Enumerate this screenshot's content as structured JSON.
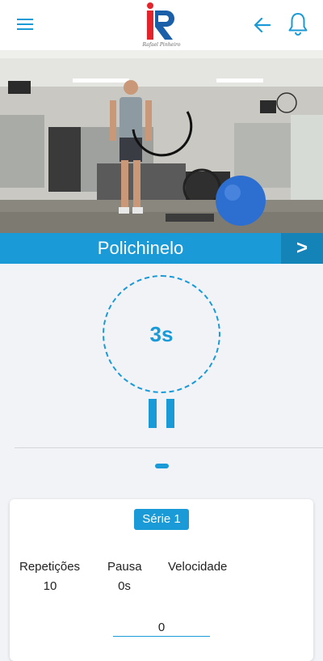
{
  "header": {
    "logo_caption": "Rafael Pinheiro",
    "menu_icon": "hamburger-menu-icon",
    "back_icon": "arrow-left-icon",
    "bell_icon": "bell-icon",
    "accent_color": "#1a9ad6"
  },
  "exercise": {
    "name": "Polichinelo",
    "next_label": ">",
    "timer": "3s"
  },
  "card": {
    "serie_label": "Série 1",
    "stats": [
      {
        "label": "Repetições",
        "value": "10"
      },
      {
        "label": "Pausa",
        "value": "0s"
      },
      {
        "label": "Velocidade",
        "value": ""
      }
    ],
    "speed_value": "0"
  }
}
